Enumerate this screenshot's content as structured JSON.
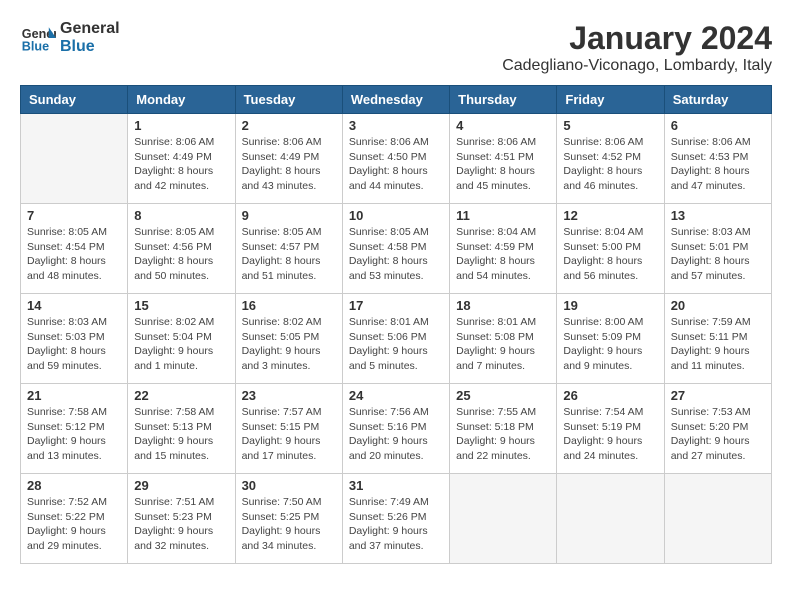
{
  "header": {
    "logo_line1": "General",
    "logo_line2": "Blue",
    "month_year": "January 2024",
    "location": "Cadegliano-Viconago, Lombardy, Italy"
  },
  "days_of_week": [
    "Sunday",
    "Monday",
    "Tuesday",
    "Wednesday",
    "Thursday",
    "Friday",
    "Saturday"
  ],
  "weeks": [
    [
      {
        "day": "",
        "info": ""
      },
      {
        "day": "1",
        "info": "Sunrise: 8:06 AM\nSunset: 4:49 PM\nDaylight: 8 hours\nand 42 minutes."
      },
      {
        "day": "2",
        "info": "Sunrise: 8:06 AM\nSunset: 4:49 PM\nDaylight: 8 hours\nand 43 minutes."
      },
      {
        "day": "3",
        "info": "Sunrise: 8:06 AM\nSunset: 4:50 PM\nDaylight: 8 hours\nand 44 minutes."
      },
      {
        "day": "4",
        "info": "Sunrise: 8:06 AM\nSunset: 4:51 PM\nDaylight: 8 hours\nand 45 minutes."
      },
      {
        "day": "5",
        "info": "Sunrise: 8:06 AM\nSunset: 4:52 PM\nDaylight: 8 hours\nand 46 minutes."
      },
      {
        "day": "6",
        "info": "Sunrise: 8:06 AM\nSunset: 4:53 PM\nDaylight: 8 hours\nand 47 minutes."
      }
    ],
    [
      {
        "day": "7",
        "info": "Sunrise: 8:05 AM\nSunset: 4:54 PM\nDaylight: 8 hours\nand 48 minutes."
      },
      {
        "day": "8",
        "info": "Sunrise: 8:05 AM\nSunset: 4:56 PM\nDaylight: 8 hours\nand 50 minutes."
      },
      {
        "day": "9",
        "info": "Sunrise: 8:05 AM\nSunset: 4:57 PM\nDaylight: 8 hours\nand 51 minutes."
      },
      {
        "day": "10",
        "info": "Sunrise: 8:05 AM\nSunset: 4:58 PM\nDaylight: 8 hours\nand 53 minutes."
      },
      {
        "day": "11",
        "info": "Sunrise: 8:04 AM\nSunset: 4:59 PM\nDaylight: 8 hours\nand 54 minutes."
      },
      {
        "day": "12",
        "info": "Sunrise: 8:04 AM\nSunset: 5:00 PM\nDaylight: 8 hours\nand 56 minutes."
      },
      {
        "day": "13",
        "info": "Sunrise: 8:03 AM\nSunset: 5:01 PM\nDaylight: 8 hours\nand 57 minutes."
      }
    ],
    [
      {
        "day": "14",
        "info": "Sunrise: 8:03 AM\nSunset: 5:03 PM\nDaylight: 8 hours\nand 59 minutes."
      },
      {
        "day": "15",
        "info": "Sunrise: 8:02 AM\nSunset: 5:04 PM\nDaylight: 9 hours\nand 1 minute."
      },
      {
        "day": "16",
        "info": "Sunrise: 8:02 AM\nSunset: 5:05 PM\nDaylight: 9 hours\nand 3 minutes."
      },
      {
        "day": "17",
        "info": "Sunrise: 8:01 AM\nSunset: 5:06 PM\nDaylight: 9 hours\nand 5 minutes."
      },
      {
        "day": "18",
        "info": "Sunrise: 8:01 AM\nSunset: 5:08 PM\nDaylight: 9 hours\nand 7 minutes."
      },
      {
        "day": "19",
        "info": "Sunrise: 8:00 AM\nSunset: 5:09 PM\nDaylight: 9 hours\nand 9 minutes."
      },
      {
        "day": "20",
        "info": "Sunrise: 7:59 AM\nSunset: 5:11 PM\nDaylight: 9 hours\nand 11 minutes."
      }
    ],
    [
      {
        "day": "21",
        "info": "Sunrise: 7:58 AM\nSunset: 5:12 PM\nDaylight: 9 hours\nand 13 minutes."
      },
      {
        "day": "22",
        "info": "Sunrise: 7:58 AM\nSunset: 5:13 PM\nDaylight: 9 hours\nand 15 minutes."
      },
      {
        "day": "23",
        "info": "Sunrise: 7:57 AM\nSunset: 5:15 PM\nDaylight: 9 hours\nand 17 minutes."
      },
      {
        "day": "24",
        "info": "Sunrise: 7:56 AM\nSunset: 5:16 PM\nDaylight: 9 hours\nand 20 minutes."
      },
      {
        "day": "25",
        "info": "Sunrise: 7:55 AM\nSunset: 5:18 PM\nDaylight: 9 hours\nand 22 minutes."
      },
      {
        "day": "26",
        "info": "Sunrise: 7:54 AM\nSunset: 5:19 PM\nDaylight: 9 hours\nand 24 minutes."
      },
      {
        "day": "27",
        "info": "Sunrise: 7:53 AM\nSunset: 5:20 PM\nDaylight: 9 hours\nand 27 minutes."
      }
    ],
    [
      {
        "day": "28",
        "info": "Sunrise: 7:52 AM\nSunset: 5:22 PM\nDaylight: 9 hours\nand 29 minutes."
      },
      {
        "day": "29",
        "info": "Sunrise: 7:51 AM\nSunset: 5:23 PM\nDaylight: 9 hours\nand 32 minutes."
      },
      {
        "day": "30",
        "info": "Sunrise: 7:50 AM\nSunset: 5:25 PM\nDaylight: 9 hours\nand 34 minutes."
      },
      {
        "day": "31",
        "info": "Sunrise: 7:49 AM\nSunset: 5:26 PM\nDaylight: 9 hours\nand 37 minutes."
      },
      {
        "day": "",
        "info": ""
      },
      {
        "day": "",
        "info": ""
      },
      {
        "day": "",
        "info": ""
      }
    ]
  ]
}
